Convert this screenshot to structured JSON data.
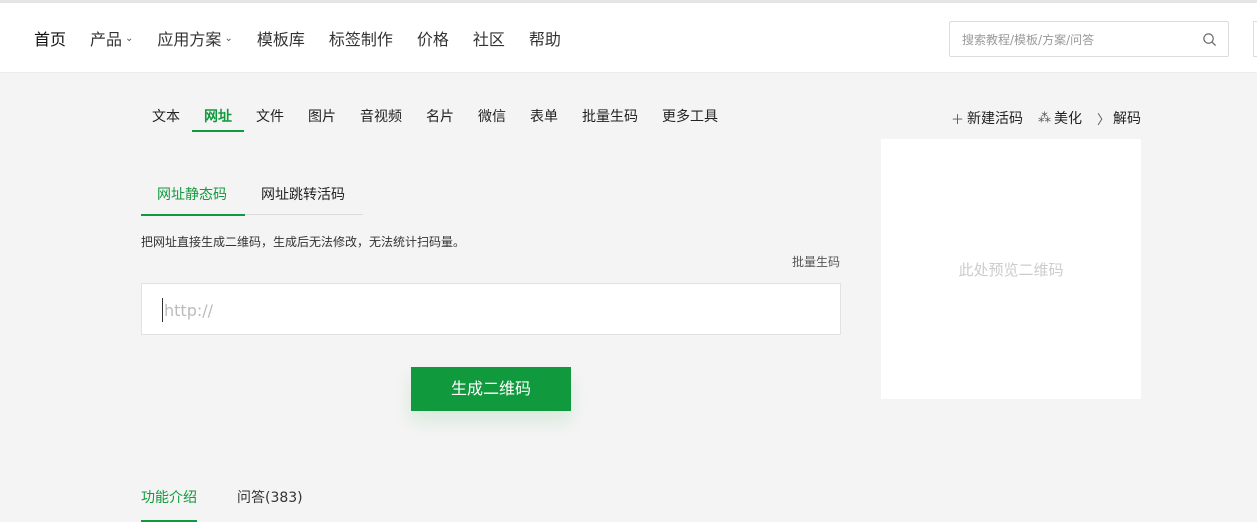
{
  "header": {
    "nav": [
      {
        "label": "首页",
        "dropdown": false
      },
      {
        "label": "产品",
        "dropdown": true
      },
      {
        "label": "应用方案",
        "dropdown": true
      },
      {
        "label": "模板库",
        "dropdown": false
      },
      {
        "label": "标签制作",
        "dropdown": false
      },
      {
        "label": "价格",
        "dropdown": false
      },
      {
        "label": "社区",
        "dropdown": false
      },
      {
        "label": "帮助",
        "dropdown": false
      }
    ],
    "search": {
      "placeholder": "搜索教程/模板/方案/问答",
      "icon": "search-icon"
    }
  },
  "tool_tabs": [
    "文本",
    "网址",
    "文件",
    "图片",
    "音视频",
    "名片",
    "微信",
    "表单",
    "批量生码",
    "更多工具"
  ],
  "active_tool_tab": "网址",
  "tools_right": [
    {
      "icon": "plus-icon",
      "label": "新建活码"
    },
    {
      "icon": "sparkle-icon",
      "label": "美化"
    },
    {
      "icon": "scan-icon",
      "label": "解码"
    }
  ],
  "sub_tabs": [
    "网址静态码",
    "网址跳转活码"
  ],
  "active_sub_tab": "网址静态码",
  "description": "把网址直接生成二维码，生成后无法修改，无法统计扫码量。",
  "batch_link": "批量生码",
  "url_input": {
    "placeholder": "http://",
    "value": ""
  },
  "generate_button": "生成二维码",
  "preview_text": "此处预览二维码",
  "bottom_tabs": [
    "功能介绍",
    "问答(383)"
  ],
  "colors": {
    "accent": "#119a3d"
  }
}
